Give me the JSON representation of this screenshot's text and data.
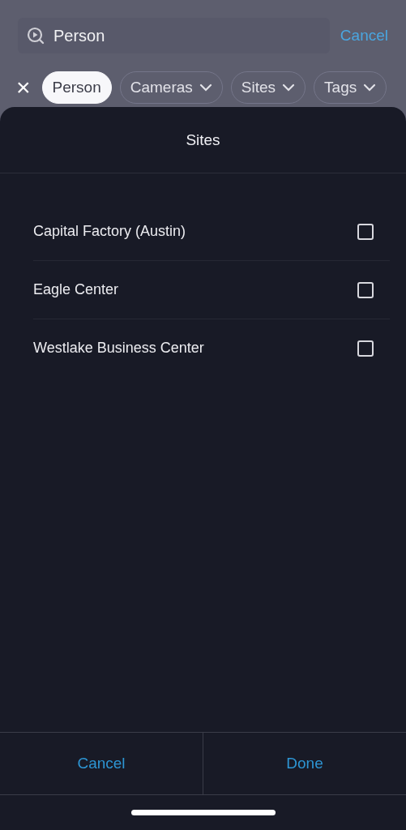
{
  "search": {
    "value": "Person",
    "cancel": "Cancel"
  },
  "chips": [
    {
      "label": "×",
      "kind": "clear"
    },
    {
      "label": "Person",
      "kind": "chip",
      "selected": true
    },
    {
      "label": "Cameras",
      "kind": "dropdown",
      "selected": false
    },
    {
      "label": "Sites",
      "kind": "dropdown",
      "selected": false
    },
    {
      "label": "Tags",
      "kind": "dropdown",
      "selected": false
    }
  ],
  "sheet": {
    "title": "Sites",
    "items": [
      {
        "label": "Capital Factory (Austin)",
        "checked": false
      },
      {
        "label": "Eagle Center",
        "checked": false
      },
      {
        "label": "Westlake Business Center",
        "checked": false
      }
    ],
    "buttons": [
      "Cancel",
      "Done"
    ]
  }
}
